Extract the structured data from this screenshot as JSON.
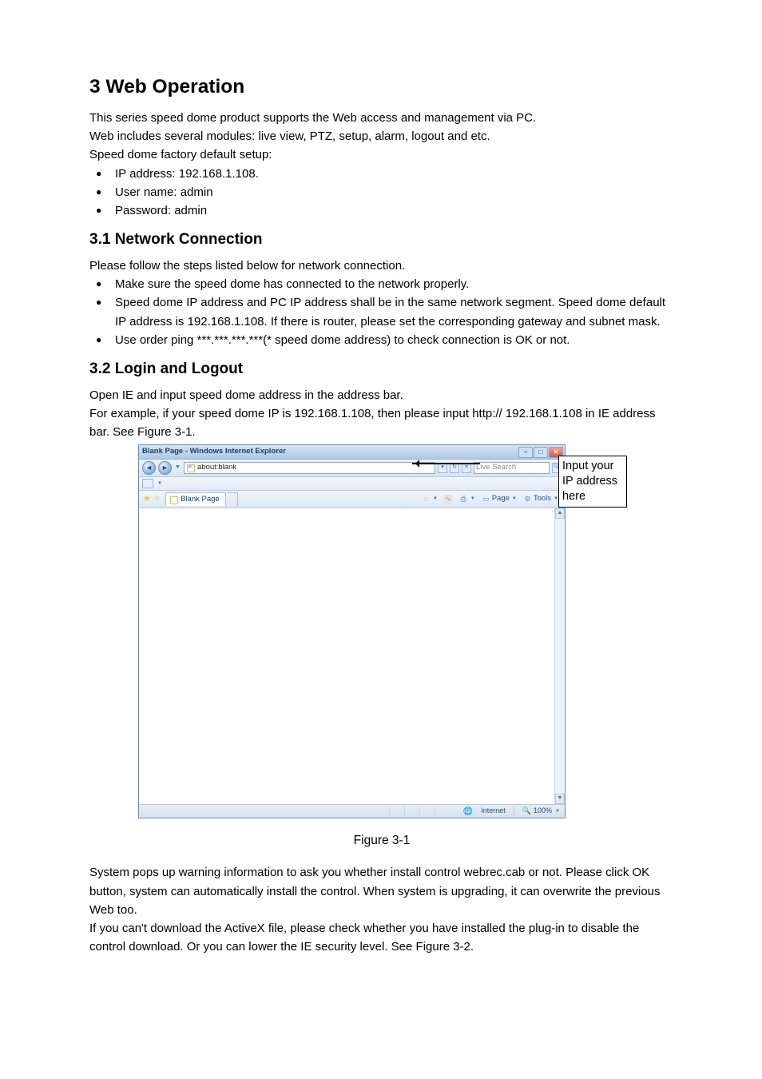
{
  "heading": {
    "chapter": "3  Web Operation"
  },
  "intro": {
    "p1": "This series speed dome product supports the Web access and management via PC.",
    "p2": "Web includes several modules: live view, PTZ, setup, alarm, logout and etc.",
    "p3": "Speed dome factory default setup:",
    "defaults": [
      "IP address: 192.168.1.108.",
      "User name: admin",
      "Password: admin"
    ]
  },
  "section31": {
    "title": "3.1  Network Connection",
    "lead": "Please follow the steps listed below for network connection.",
    "items": [
      "Make sure the speed dome has connected to the network properly.",
      "Speed dome IP address and PC IP address shall be in the same network segment. Speed dome default IP address is 192.168.1.108. If there is router, please set the corresponding gateway and subnet mask.",
      "Use order ping ***.***.***.***(* speed dome address) to check connection is OK or not."
    ]
  },
  "section32": {
    "title": "3.2  Login and Logout",
    "p1": "Open IE and input speed dome address in the address bar.",
    "p2": "For example, if your speed dome IP is 192.168.1.108, then please input http:// 192.168.1.108 in IE address bar. See Figure 3-1."
  },
  "ie": {
    "title": "Blank Page - Windows Internet Explorer",
    "address": "about:blank",
    "searchPlaceholder": "Live Search",
    "tabLabel": "Blank Page",
    "cmd": {
      "page": "Page",
      "tools": "Tools"
    },
    "status": {
      "zone": "Internet",
      "zoom": "100%"
    }
  },
  "callout": "Input your IP address here",
  "figcap": "Figure 3-1",
  "after": {
    "p1": "System pops up warning information to ask you whether install control webrec.cab  or not. Please click OK button, system can automatically install the control. When system is upgrading, it can overwrite the previous Web too.",
    "p2": "If you can't download the ActiveX file, please check whether you have installed the plug-in to disable the control download. Or you can lower the IE security level. See Figure 3-2."
  }
}
